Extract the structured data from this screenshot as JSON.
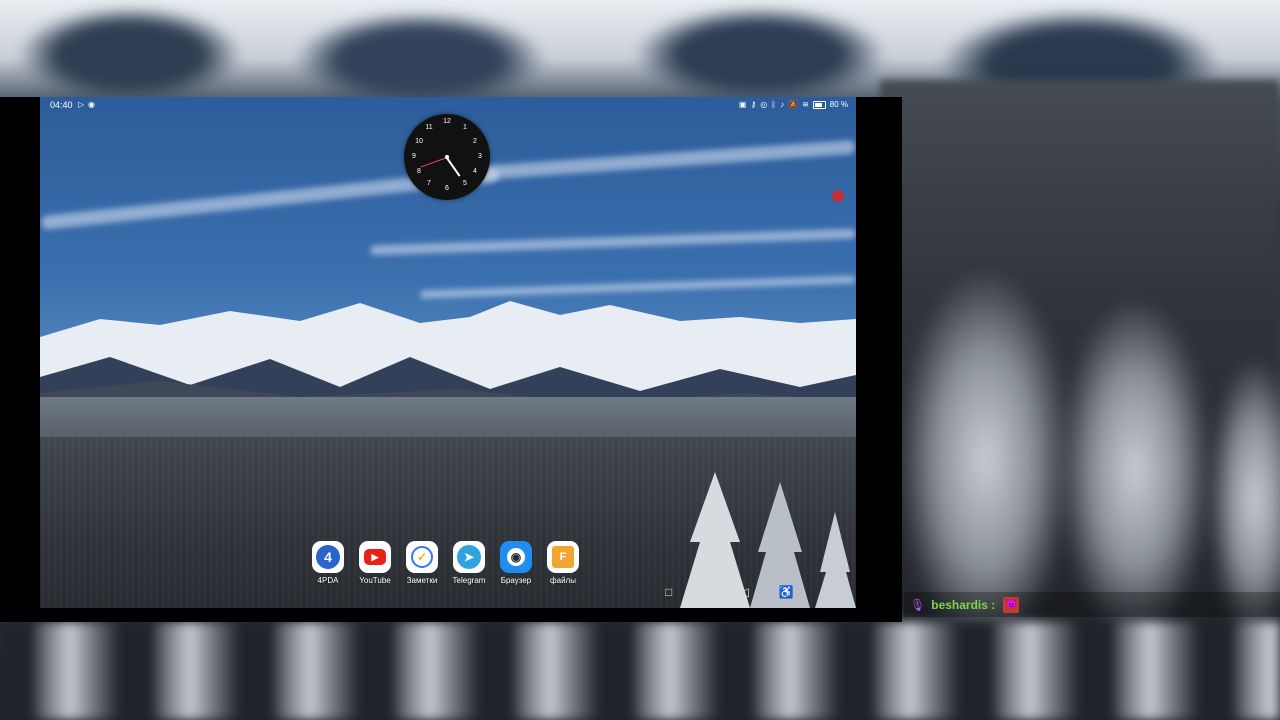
{
  "status_bar": {
    "time": "04:40",
    "battery": "80 %"
  },
  "clock_widget": {
    "numbers": [
      "12",
      "1",
      "2",
      "3",
      "4",
      "5",
      "6",
      "7",
      "8",
      "9",
      "10",
      "11"
    ]
  },
  "dock": {
    "apps": [
      {
        "label": "4PDA",
        "glyph": "4",
        "icon": "4pda-icon",
        "color": "#2a63c9"
      },
      {
        "label": "YouTube",
        "glyph": "▶",
        "icon": "youtube-icon",
        "color": "#e62117"
      },
      {
        "label": "Заметки",
        "glyph": "✓",
        "icon": "notes-icon",
        "color": "#ffffff"
      },
      {
        "label": "Telegram",
        "glyph": "➤",
        "icon": "telegram-icon",
        "color": "#2fa3e0"
      },
      {
        "label": "Браузер",
        "glyph": "◉",
        "icon": "browser-icon",
        "color": "#1f8ef0"
      },
      {
        "label": "файлы",
        "glyph": "F",
        "icon": "files-icon",
        "color": "#f3a533"
      }
    ]
  },
  "nav": {
    "recents": "□",
    "home": "○",
    "back": "◁",
    "accessibility": "♿"
  },
  "chat": {
    "username": "beshardis :",
    "emote": "😈"
  }
}
